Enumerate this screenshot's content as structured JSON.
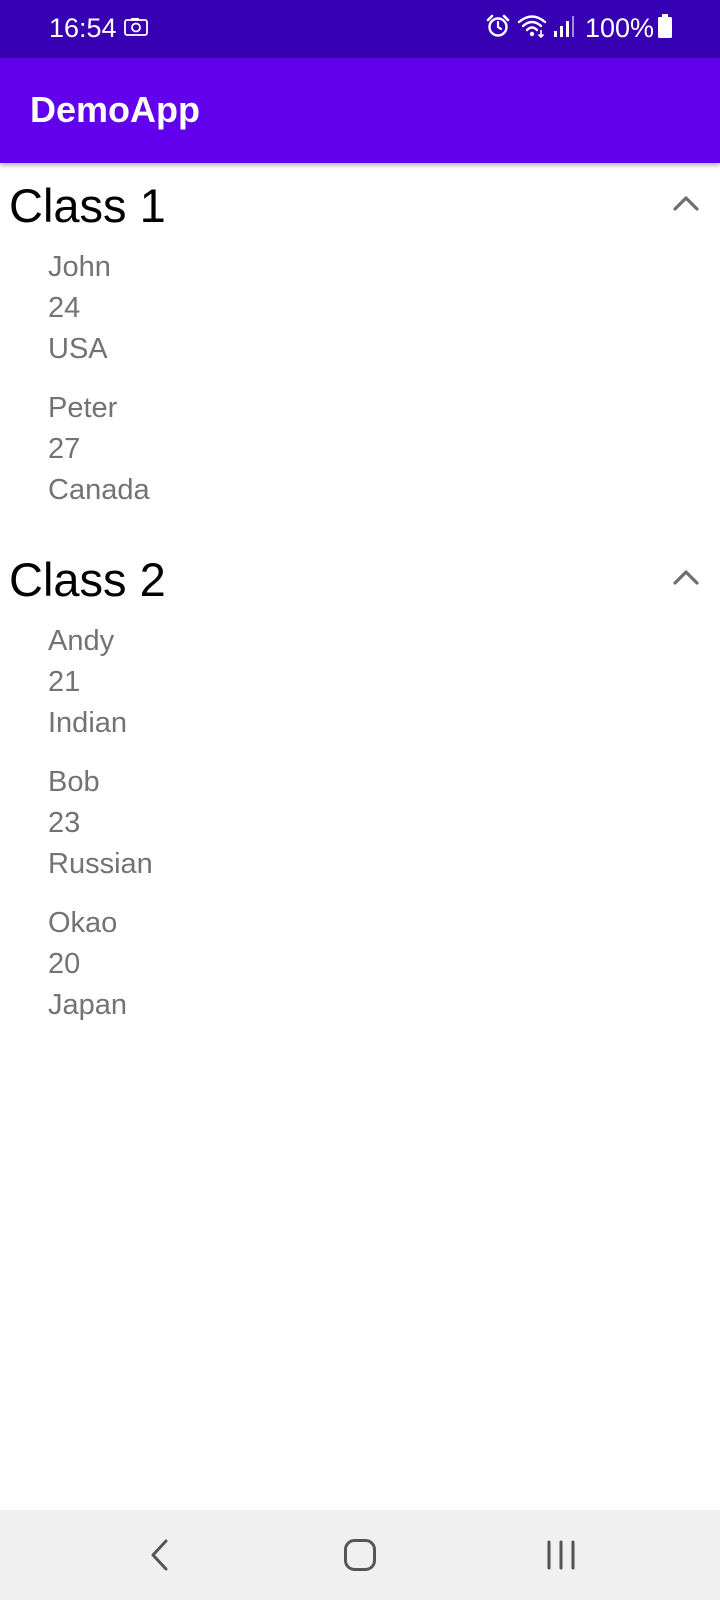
{
  "status_bar": {
    "time": "16:54",
    "battery": "100%",
    "icons": [
      "screenshot-icon",
      "alarm-icon",
      "wifi-icon",
      "signal-icon",
      "battery-icon"
    ]
  },
  "app_bar": {
    "title": "DemoApp",
    "color": "#6200ee",
    "status_color": "#3700b3"
  },
  "groups": [
    {
      "title": "Class 1",
      "expanded": true,
      "students": [
        {
          "name": "John",
          "age": "24",
          "country": "USA"
        },
        {
          "name": "Peter",
          "age": "27",
          "country": "Canada"
        }
      ]
    },
    {
      "title": "Class 2",
      "expanded": true,
      "students": [
        {
          "name": "Andy",
          "age": "21",
          "country": "Indian"
        },
        {
          "name": "Bob",
          "age": "23",
          "country": "Russian"
        },
        {
          "name": "Okao",
          "age": "20",
          "country": "Japan"
        }
      ]
    }
  ],
  "nav_bar": {
    "icons": [
      "back-icon",
      "home-icon",
      "recents-icon"
    ]
  }
}
